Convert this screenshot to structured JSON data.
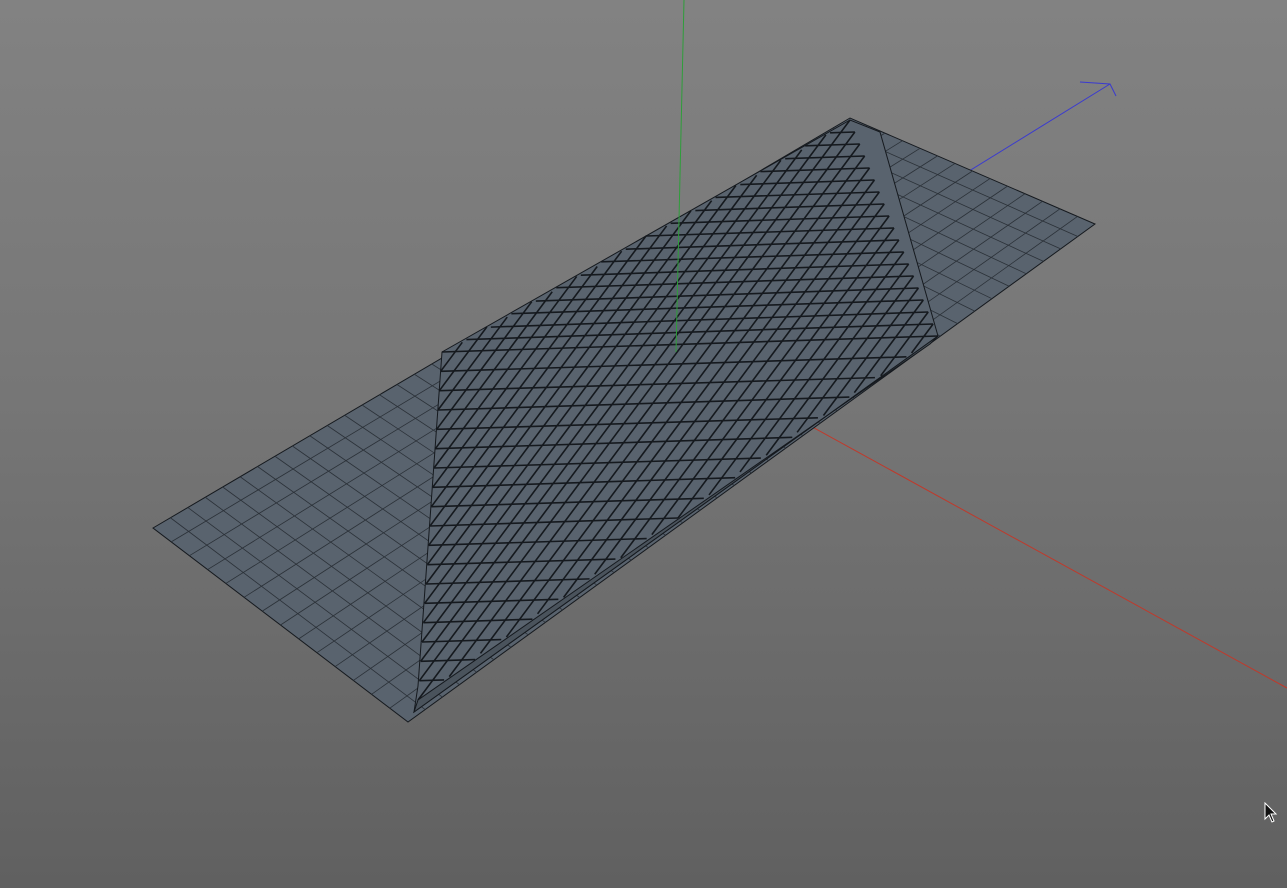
{
  "viewport": {
    "background_top": "#828282",
    "background_bottom": "#606060"
  },
  "axes": {
    "x_color": "#c0392b",
    "y_color": "#2e9e3a",
    "z_color": "#3a3ad0"
  },
  "mesh": {
    "fill_color": "#59636e",
    "wire_color": "#2b3138",
    "heavy_wire_color": "#15191e"
  },
  "cursor": {
    "icon": "arrow-cursor-icon"
  }
}
